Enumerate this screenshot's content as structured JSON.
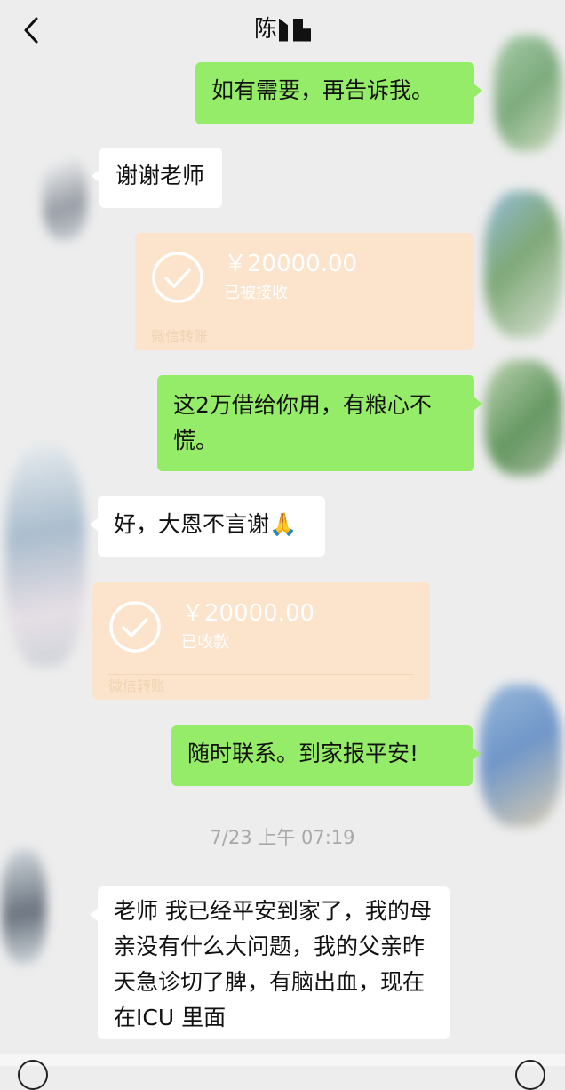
{
  "header": {
    "title": "陈",
    "back_icon": "chevron-left-icon"
  },
  "colors": {
    "background": "#ededed",
    "sent_bubble": "#95ec69",
    "received_bubble": "#ffffff",
    "transfer_card": "#fbe4cb"
  },
  "messages": [
    {
      "side": "sent",
      "text": "如有需要，再告诉我。"
    },
    {
      "side": "received",
      "text": "谢谢老师"
    },
    {
      "side": "sent",
      "type": "transfer",
      "amount": "￥20000.00",
      "status": "已被接收",
      "label": "微信转账"
    },
    {
      "side": "sent",
      "text": "这2万借给你用，有粮心不慌。"
    },
    {
      "side": "received",
      "text": "好，大恩不言谢🙏"
    },
    {
      "side": "received",
      "type": "transfer",
      "amount": "￥20000.00",
      "status": "已收款",
      "label": "微信转账"
    },
    {
      "side": "sent",
      "text": "随时联系。到家报平安!"
    },
    {
      "type": "timestamp",
      "text": "7/23 上午 07:19"
    },
    {
      "side": "received",
      "text": "老师 我已经平安到家了，我的母亲没有什么大问题，我的父亲昨天急诊切了脾，有脑出血，现在在ICU 里面"
    }
  ]
}
